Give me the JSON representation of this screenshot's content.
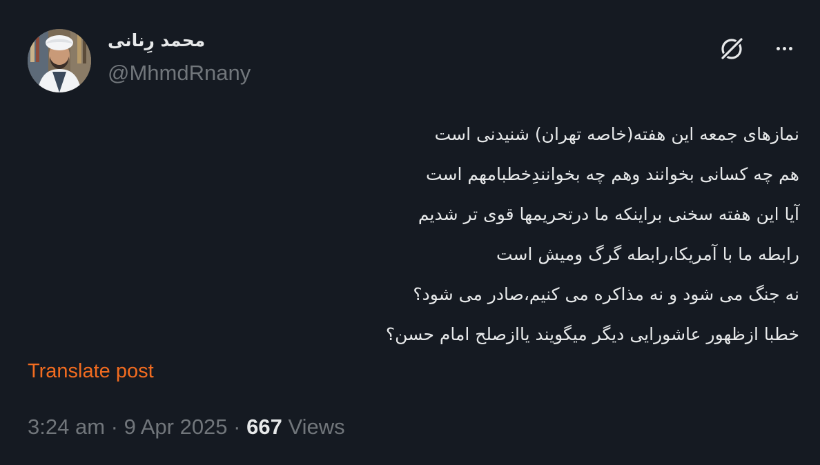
{
  "author": {
    "display_name": "محمد رِنانی",
    "handle": "@MhmdRnany"
  },
  "icons": {
    "grok": "grok-slash-icon",
    "more": "more-dots-icon"
  },
  "post": {
    "lines": [
      "نمازهای جمعه این هفته(خاصه تهران) شنیدنی است",
      "هم چه کسانی بخوانند وهم چه بخوانندِخطبامهم است",
      "آیا این هفته سخنی براینکه ما درتحریمها قوی تر شدیم",
      "رابطه ما با آمریکا،رابطه گرگ ومیش است",
      "نه جنگ می شود و نه مذاکره می کنیم،صادر می شود؟",
      "خطبا ازظهور عاشورایی دیگر میگویند یاازصلح امام حسن؟"
    ],
    "translate_label": "Translate post"
  },
  "meta": {
    "time": "3:24 am",
    "sep1": " · ",
    "date": "9 Apr 2025",
    "sep2": " · ",
    "views_count": "667",
    "views_label": " Views"
  },
  "colors": {
    "background": "#151a22",
    "text": "#e7e9ea",
    "secondary": "#71767b",
    "link": "#f26c20"
  }
}
